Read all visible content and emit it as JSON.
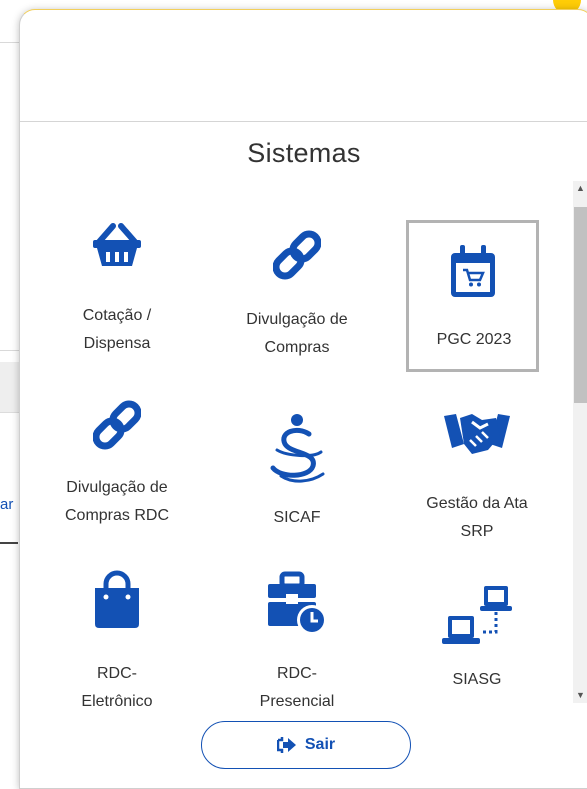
{
  "panel": {
    "title": "Sistemas",
    "logout_label": "Sair"
  },
  "background": {
    "peek_text": "ar"
  },
  "systems": [
    {
      "label_1": "Cotação /",
      "label_2": "Dispensa",
      "icon": "basket-icon"
    },
    {
      "label_1": "Divulgação de",
      "label_2": "Compras",
      "icon": "link-icon"
    },
    {
      "label_1": "PGC 2023",
      "label_2": "",
      "icon": "calendar-cart-icon",
      "selected": true
    },
    {
      "label_1": "Divulgação de",
      "label_2": "Compras RDC",
      "icon": "link-icon"
    },
    {
      "label_1": "SICAF",
      "label_2": "",
      "icon": "sicaf-logo-icon"
    },
    {
      "label_1": "Gestão da Ata",
      "label_2": "SRP",
      "icon": "handshake-icon"
    },
    {
      "label_1": "RDC-",
      "label_2": "Eletrônico",
      "icon": "shopping-bag-icon"
    },
    {
      "label_1": "RDC-",
      "label_2": "Presencial",
      "icon": "briefcase-clock-icon"
    },
    {
      "label_1": "SIASG",
      "label_2": "",
      "icon": "network-computers-icon"
    }
  ],
  "colors": {
    "accent": "#1351b4",
    "selected_border": "#b3b3b3",
    "notification": "#ffcd07"
  }
}
